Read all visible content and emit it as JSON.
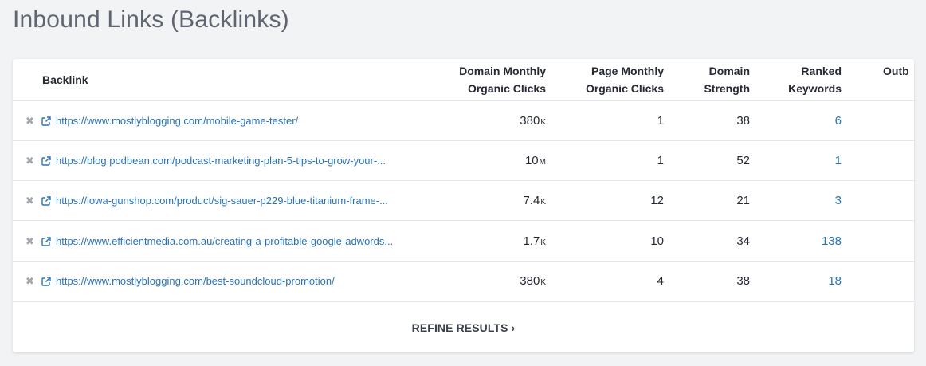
{
  "page": {
    "title": "Inbound Links (Backlinks)"
  },
  "table": {
    "columns": {
      "backlink": "Backlink",
      "domain_monthly_1": "Domain Monthly",
      "domain_monthly_2": "Organic Clicks",
      "page_monthly_1": "Page Monthly",
      "page_monthly_2": "Organic Clicks",
      "domain_strength_1": "Domain",
      "domain_strength_2": "Strength",
      "ranked_keywords_1": "Ranked",
      "ranked_keywords_2": "Keywords",
      "outbound_partial": "Outb"
    },
    "rows": [
      {
        "url": "https://www.mostlyblogging.com/mobile-game-tester/",
        "dmc_value": "380",
        "dmc_suffix": "K",
        "pmc": "1",
        "ds": "38",
        "rk": "6"
      },
      {
        "url": "https://blog.podbean.com/podcast-marketing-plan-5-tips-to-grow-your-...",
        "dmc_value": "10",
        "dmc_suffix": "M",
        "pmc": "1",
        "ds": "52",
        "rk": "1"
      },
      {
        "url": "https://iowa-gunshop.com/product/sig-sauer-p229-blue-titanium-frame-...",
        "dmc_value": "7.4",
        "dmc_suffix": "K",
        "pmc": "12",
        "ds": "21",
        "rk": "3"
      },
      {
        "url": "https://www.efficientmedia.com.au/creating-a-profitable-google-adwords...",
        "dmc_value": "1.7",
        "dmc_suffix": "K",
        "pmc": "10",
        "ds": "34",
        "rk": "138"
      },
      {
        "url": "https://www.mostlyblogging.com/best-soundcloud-promotion/",
        "dmc_value": "380",
        "dmc_suffix": "K",
        "pmc": "4",
        "ds": "38",
        "rk": "18"
      }
    ],
    "remove_glyph": "✖"
  },
  "footer": {
    "refine_label": "REFINE RESULTS",
    "refine_chevron": "›"
  },
  "colors": {
    "link": "#2b73b6",
    "text": "#262a33",
    "title": "#5f6571"
  },
  "icons": {
    "remove": "remove-icon",
    "external": "external-link-icon"
  }
}
